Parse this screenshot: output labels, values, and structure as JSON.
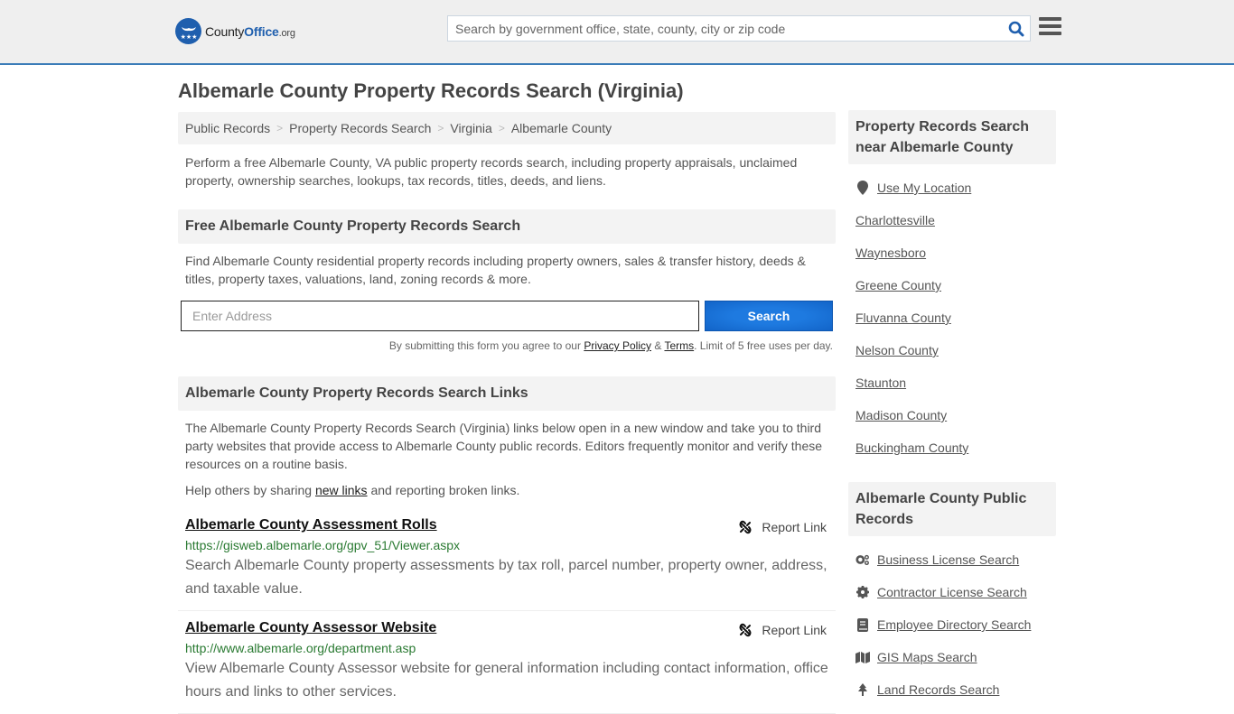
{
  "header": {
    "logo": {
      "name_part1": "County",
      "name_part2": "Office",
      "suffix": ".org"
    },
    "search": {
      "placeholder": "Search by government office, state, county, city or zip code",
      "value": ""
    },
    "accent_color": "#3a7cb8"
  },
  "page": {
    "title": "Albemarle County Property Records Search (Virginia)"
  },
  "breadcrumb": [
    "Public Records",
    "Property Records Search",
    "Virginia",
    "Albemarle County"
  ],
  "intro": "Perform a free Albemarle County, VA public property records search, including property appraisals, unclaimed property, ownership searches, lookups, tax records, titles, deeds, and liens.",
  "free_search": {
    "heading": "Free Albemarle County Property Records Search",
    "description": "Find Albemarle County residential property records including property owners, sales & transfer history, deeds & titles, property taxes, valuations, land, zoning records & more.",
    "input_placeholder": "Enter Address",
    "input_value": "",
    "button_label": "Search",
    "terms_prefix": "By submitting this form you agree to our ",
    "privacy_label": "Privacy Policy",
    "terms_amp": " & ",
    "terms_label": "Terms",
    "terms_suffix": ". Limit of 5 free uses per day."
  },
  "links_section": {
    "heading": "Albemarle County Property Records Search Links",
    "description": "The Albemarle County Property Records Search (Virginia) links below open in a new window and take you to third party websites that provide access to Albemarle County public records. Editors frequently monitor and verify these resources on a routine basis.",
    "help_prefix": "Help others by sharing ",
    "help_link": "new links",
    "help_suffix": " and reporting broken links.",
    "report_label": "Report Link",
    "items": [
      {
        "title": "Albemarle County Assessment Rolls",
        "url": "https://gisweb.albemarle.org/gpv_51/Viewer.aspx",
        "description": "Search Albemarle County property assessments by tax roll, parcel number, property owner, address, and taxable value."
      },
      {
        "title": "Albemarle County Assessor Website",
        "url": "http://www.albemarle.org/department.asp",
        "description": "View Albemarle County Assessor website for general information including contact information, office hours and links to other services."
      }
    ]
  },
  "sidebar": {
    "nearby": {
      "heading": "Property Records Search near Albemarle County",
      "use_location": "Use My Location",
      "places": [
        "Charlottesville",
        "Waynesboro",
        "Greene County",
        "Fluvanna County",
        "Nelson County",
        "Staunton",
        "Madison County",
        "Buckingham County"
      ]
    },
    "public_records": {
      "heading": "Albemarle County Public Records",
      "items": [
        {
          "label": "Business License Search",
          "icon": "cogs-icon"
        },
        {
          "label": "Contractor License Search",
          "icon": "gear-icon"
        },
        {
          "label": "Employee Directory Search",
          "icon": "book-icon"
        },
        {
          "label": "GIS Maps Search",
          "icon": "map-icon"
        },
        {
          "label": "Land Records Search",
          "icon": "tree-icon"
        }
      ]
    }
  }
}
